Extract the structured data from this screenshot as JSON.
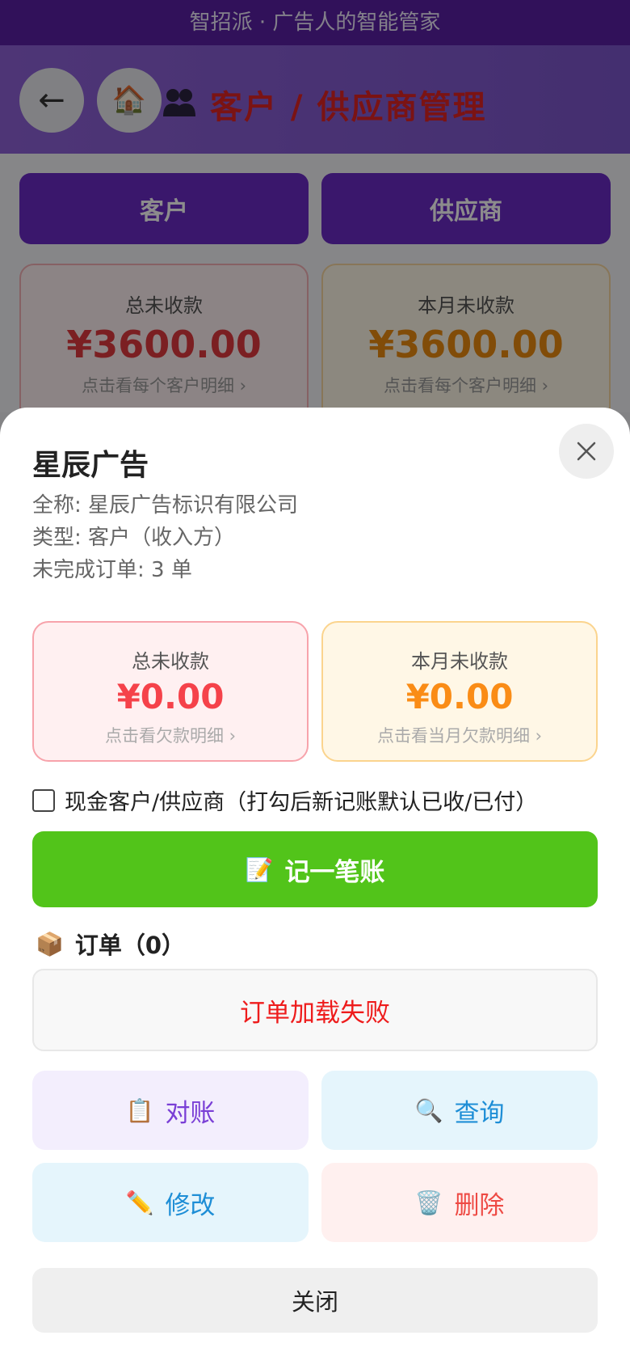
{
  "app": {
    "banner": "智招派 · 广告人的智能管家"
  },
  "header": {
    "back_icon": "←",
    "home_icon": "🏠",
    "title": "客户 / 供应商管理"
  },
  "background": {
    "tabs": [
      "客户",
      "供应商"
    ],
    "stats": [
      {
        "label": "总未收款",
        "value": "¥3600.00",
        "hint": "点击看每个客户明细 ›"
      },
      {
        "label": "本月未收款",
        "value": "¥3600.00",
        "hint": "点击看每个客户明细 ›"
      }
    ]
  },
  "modal": {
    "name": "星辰广告",
    "full_name": "全称: 星辰广告标识有限公司",
    "type": "类型: 客户（收入方）",
    "pending_orders": "未完成订单: 3 单",
    "cards": [
      {
        "label": "总未收款",
        "value": "¥0.00",
        "hint": "点击看欠款明细 ›"
      },
      {
        "label": "本月未收款",
        "value": "¥0.00",
        "hint": "点击看当月欠款明细 ›"
      }
    ],
    "cash_label": "现金客户/供应商（打勾后新记账默认已收/已付）",
    "record_button": {
      "icon": "📝",
      "label": "记一笔账"
    },
    "orders": {
      "icon": "📦",
      "title": "订单（0）",
      "error": "订单加载失败"
    },
    "actions": [
      {
        "icon": "📋",
        "label": "对账"
      },
      {
        "icon": "🔍",
        "label": "查询"
      },
      {
        "icon": "✏️",
        "label": "修改"
      },
      {
        "icon": "🗑️",
        "label": "删除"
      }
    ],
    "close_label": "关闭"
  },
  "colors": {
    "purple": "#5a1fa5",
    "title_red": "#e02424",
    "green": "#52c41a",
    "red": "#f5424a",
    "orange": "#fa8c16"
  }
}
